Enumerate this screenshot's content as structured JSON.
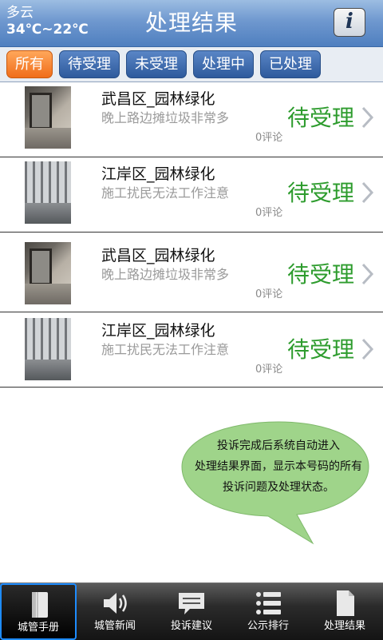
{
  "header": {
    "weather_condition": "多云",
    "temperature": "34℃~22℃",
    "title": "处理结果",
    "info_label": "i"
  },
  "filters": [
    {
      "label": "所有",
      "active": true
    },
    {
      "label": "待受理",
      "active": false
    },
    {
      "label": "未受理",
      "active": false
    },
    {
      "label": "处理中",
      "active": false
    },
    {
      "label": "已处理",
      "active": false
    }
  ],
  "items": [
    {
      "title": "武昌区_园林绿化",
      "description": "晚上路边摊垃圾非常多",
      "comments": "0评论",
      "status": "待受理"
    },
    {
      "title": "江岸区_园林绿化",
      "description": "施工扰民无法工作注意",
      "comments": "0评论",
      "status": "待受理"
    },
    {
      "title": "武昌区_园林绿化",
      "description": "晚上路边摊垃圾非常多",
      "comments": "0评论",
      "status": "待受理"
    },
    {
      "title": "江岸区_园林绿化",
      "description": "施工扰民无法工作注意",
      "comments": "0评论",
      "status": "待受理"
    }
  ],
  "tooltip": {
    "line1": "投诉完成后系统自动进入",
    "line2": "处理结果界面，显示本号码的所有",
    "line3": "投诉问题及处理状态。"
  },
  "bottom_nav": [
    {
      "label": "城管手册",
      "icon": "book-icon",
      "active": true
    },
    {
      "label": "城管新闻",
      "icon": "speaker-icon",
      "active": false
    },
    {
      "label": "投诉建议",
      "icon": "chat-bubble-icon",
      "active": false
    },
    {
      "label": "公示排行",
      "icon": "list-icon",
      "active": false
    },
    {
      "label": "处理结果",
      "icon": "document-icon",
      "active": false
    }
  ],
  "colors": {
    "header_blue": "#6f98cf",
    "active_tab": "#f07a26",
    "tab_blue": "#3f6cae",
    "status_green": "#2e9c2e",
    "bubble_green": "#9fd48a",
    "nav_active_border": "#1e8cff"
  }
}
